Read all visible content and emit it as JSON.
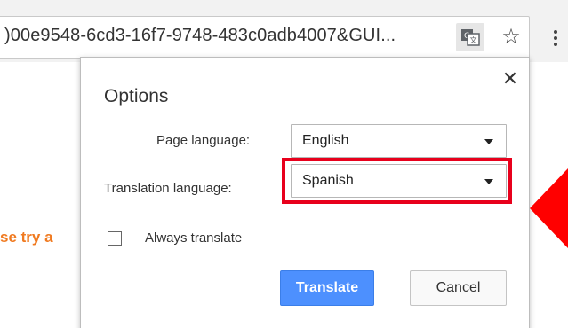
{
  "browser": {
    "url_text": ")00e9548-6cd3-16f7-9748-483c0adb4007&GUI...",
    "translate_icon": "translate-icon",
    "star_icon": "star-icon",
    "star_glyph": "☆",
    "menu_icon": "more-vert-icon"
  },
  "page": {
    "partial_text": "se try a"
  },
  "popup": {
    "title": "Options",
    "close_glyph": "✕",
    "page_language_label": "Page language:",
    "page_language_value": "English",
    "translation_language_label": "Translation language:",
    "translation_language_value": "Spanish",
    "always_translate_label": "Always translate",
    "always_translate_checked": false,
    "translate_button": "Translate",
    "cancel_button": "Cancel"
  },
  "annotations": {
    "highlight_color": "#e8001c",
    "arrow_color": "#ff0000"
  },
  "colors": {
    "accent_blue": "#4d90fe",
    "page_text_orange": "#f07a20"
  }
}
